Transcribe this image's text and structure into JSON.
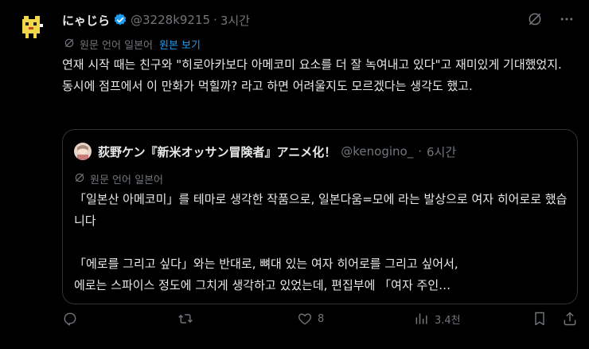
{
  "tweet": {
    "display_name": "にゃじら",
    "handle": "@3228k9215",
    "separator": "·",
    "time": "3시간",
    "translate_label": "원문 언어 일본어",
    "translate_link": "원본 보기",
    "text": "연재 시작 때는 친구와 \"히로아카보다 아메코미 요소를 더 잘 녹여내고 있다\"고 재미있게 기대했었지. 동시에 점프에서 이 만화가 먹힐까? 라고 하면 어려울지도 모르겠다는 생각도 했고."
  },
  "quote": {
    "display_name": "荻野ケン『新米オッサン冒険者』アニメ化！",
    "handle": "@kenogino_",
    "separator": "·",
    "time": "6시간",
    "translate_label": "원문 언어 일본어",
    "paragraph1": "「일본산 아메코미」를 테마로 생각한 작품으로, 일본다움=모에 라는 발상으로 여자 히어로로 했습니다",
    "paragraph2_line1": "「에로를 그리고 싶다」와는 반대로, 뼈대 있는 여자 히어로를 그리고 싶어서,",
    "paragraph2_line2": "에로는 스파이스 정도에 그치게 생각하고 있었는데, 편집부에 「여자 주인…"
  },
  "actions": {
    "reply_count": "",
    "retweet_count": "",
    "like_count": "8",
    "views_count": "3.4천"
  },
  "icons": {
    "verified": "verified-badge-icon",
    "grok": "grok-icon",
    "more": "more-icon",
    "translate": "translate-icon",
    "reply": "reply-icon",
    "retweet": "retweet-icon",
    "like": "like-icon",
    "views": "views-icon",
    "bookmark": "bookmark-icon",
    "share": "share-icon"
  },
  "colors": {
    "background": "#000000",
    "text": "#e7e9ea",
    "muted": "#71767b",
    "link": "#1d9bf0",
    "border": "#2f3336"
  }
}
